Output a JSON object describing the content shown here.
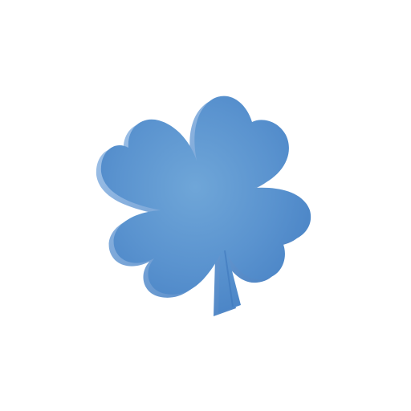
{
  "image": {
    "subject": "four-leaf-clover-icon",
    "background_color": "#ffffff",
    "colors": {
      "face_light": "#6fa6d8",
      "face_mid": "#5a93cf",
      "face_dark": "#4a84c6",
      "edge_light": "#a9c9ec",
      "edge_dark": "#3d78bd"
    }
  }
}
